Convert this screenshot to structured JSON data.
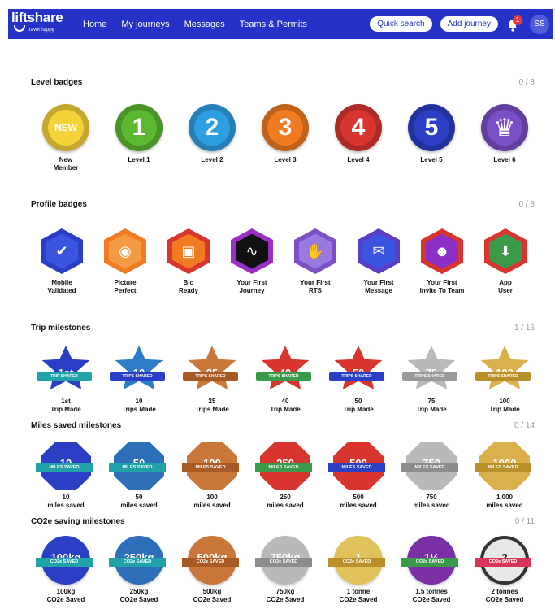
{
  "nav": {
    "logo": "liftshare",
    "logo_sub": "travel happy",
    "links": [
      "Home",
      "My journeys",
      "Messages",
      "Teams & Permits"
    ],
    "quick_search": "Quick search",
    "add_journey": "Add journey",
    "notification_count": "1",
    "avatar_initials": "SS"
  },
  "sections": {
    "level": {
      "title": "Level badges",
      "count": "0 / 8",
      "badges": [
        {
          "label": "New\nMember",
          "text": "NEW",
          "color": "#f6d23a"
        },
        {
          "label": "Level 1",
          "text": "1",
          "color": "#5cb830"
        },
        {
          "label": "Level 2",
          "text": "2",
          "color": "#2e9ee3"
        },
        {
          "label": "Level 3",
          "text": "3",
          "color": "#f07b20"
        },
        {
          "label": "Level 4",
          "text": "4",
          "color": "#d9352f"
        },
        {
          "label": "Level 5",
          "text": "5",
          "color": "#2a3fc4"
        },
        {
          "label": "Level 6",
          "text": "♛",
          "color": "#7b4fc6"
        }
      ]
    },
    "profile": {
      "title": "Profile badges",
      "count": "0 / 8",
      "badges": [
        {
          "label": "Mobile\nValidated",
          "icon": "phone-check-icon",
          "color": "#2a3fc4",
          "inner": "#3b55e0"
        },
        {
          "label": "Picture\nPerfect",
          "icon": "camera-icon",
          "color": "#f07b20",
          "inner": "#f29b43"
        },
        {
          "label": "Bio\nReady",
          "icon": "id-card-icon",
          "color": "#d9352f",
          "inner": "#f07b20"
        },
        {
          "label": "Your First\nJourney",
          "icon": "route-icon",
          "color": "#9a2fc6",
          "inner": "#111111"
        },
        {
          "label": "Your First\nRTS",
          "icon": "handshake-icon",
          "color": "#7b4fc6",
          "inner": "#9b7ae0"
        },
        {
          "label": "Your First\nMessage",
          "icon": "envelope-icon",
          "color": "#5a3fc6",
          "inner": "#3b55e0"
        },
        {
          "label": "Your First\nInvite To Team",
          "icon": "team-icon",
          "color": "#d9352f",
          "inner": "#8c2fc6"
        },
        {
          "label": "App\nUser",
          "icon": "app-download-icon",
          "color": "#d9352f",
          "inner": "#3a9a4a"
        }
      ]
    },
    "trips": {
      "title": "Trip milestones",
      "count": "1 / 16",
      "ribbon": "TRIPS SHARED",
      "badges": [
        {
          "label": "1st\nTrip Made",
          "text": "1st",
          "color": "#2a3fc4",
          "ribbon_color": "#1fa3a8",
          "ribbon": "TRIP SHARED"
        },
        {
          "label": "10\nTrips Made",
          "text": "10",
          "color": "#2d7cc9",
          "ribbon_color": "#2a3fc4",
          "ribbon": "TRIPS SHARED"
        },
        {
          "label": "25\nTrips Made",
          "text": "25",
          "color": "#c9783a",
          "ribbon_color": "#a85a24",
          "ribbon": "TRIPS SHARED"
        },
        {
          "label": "40\nTrip Made",
          "text": "40",
          "color": "#d9352f",
          "ribbon_color": "#3a9a4a",
          "ribbon": "TRIPS SHARED"
        },
        {
          "label": "50\nTrip Made",
          "text": "50",
          "color": "#d9352f",
          "ribbon_color": "#2a3fc4",
          "ribbon": "TRIPS SHARED"
        },
        {
          "label": "75\nTrip Made",
          "text": "75",
          "color": "#b9b9b9",
          "ribbon_color": "#9a9a9a",
          "ribbon": "TRIPS SHARED"
        },
        {
          "label": "100\nTrip Made",
          "text": "100",
          "color": "#d9b04a",
          "ribbon_color": "#b98f2a",
          "ribbon": "TRIPS SHARED"
        }
      ]
    },
    "miles": {
      "title": "Miles saved milestones",
      "count": "0 / 14",
      "badges": [
        {
          "label": "10\nmiles saved",
          "text": "10",
          "color": "#2a3fc4",
          "ribbon_color": "#1fa3a8",
          "ribbon": "MILES SAVED"
        },
        {
          "label": "50\nmiles saved",
          "text": "50",
          "color": "#2d6fb9",
          "ribbon_color": "#1fa3a8",
          "ribbon": "MILES SAVED"
        },
        {
          "label": "100\nmiles saved",
          "text": "100",
          "color": "#c9783a",
          "ribbon_color": "#a85a24",
          "ribbon": "MILES SAVED"
        },
        {
          "label": "250\nmiles saved",
          "text": "250",
          "color": "#d9352f",
          "ribbon_color": "#3a9a4a",
          "ribbon": "MILES SAVED"
        },
        {
          "label": "500\nmiles saved",
          "text": "500",
          "color": "#d9352f",
          "ribbon_color": "#2a3fc4",
          "ribbon": "MILES SAVED"
        },
        {
          "label": "750\nmiles saved",
          "text": "750",
          "color": "#b9b9b9",
          "ribbon_color": "#8c8c8c",
          "ribbon": "MILES SAVED"
        },
        {
          "label": "1,000\nmiles saved",
          "text": "1000",
          "color": "#d9b04a",
          "ribbon_color": "#b98f2a",
          "ribbon": "MILES SAVED"
        }
      ]
    },
    "co2": {
      "title": "CO2e saving milestones",
      "count": "0 / 11",
      "badges": [
        {
          "label": "100kg\nCO2e Saved",
          "text": "100kg",
          "color": "#2a3fc4",
          "ribbon_color": "#1fa3a8",
          "ribbon": "CO2e SAVED"
        },
        {
          "label": "250kg\nCO2e Saved",
          "text": "250kg",
          "color": "#2d6fb9",
          "ribbon_color": "#1fa3a8",
          "ribbon": "CO2e SAVED"
        },
        {
          "label": "500kg\nCO2e Saved",
          "text": "500kg",
          "color": "#c9783a",
          "ribbon_color": "#a85a24",
          "ribbon": "CO2e SAVED"
        },
        {
          "label": "750kg\nCO2e Saved",
          "text": "750kg",
          "color": "#b9b9b9",
          "ribbon_color": "#8c8c8c",
          "ribbon": "CO2e SAVED"
        },
        {
          "label": "1 tonne\nCO2e Saved",
          "text": "1",
          "color": "#e0c25a",
          "ribbon_color": "#b98f2a",
          "ribbon": "CO2e SAVED"
        },
        {
          "label": "1.5 tonnes\nCO2e Saved",
          "text": "1½",
          "color": "#7b2fa6",
          "ribbon_color": "#3a9a4a",
          "ribbon": "CO2e SAVED"
        },
        {
          "label": "2 tonnes\nCO2e Saved",
          "text": "2",
          "color": "#e8e8e8",
          "ribbon_color": "#d9355a",
          "ribbon": "CO2e SAVED"
        }
      ]
    }
  }
}
